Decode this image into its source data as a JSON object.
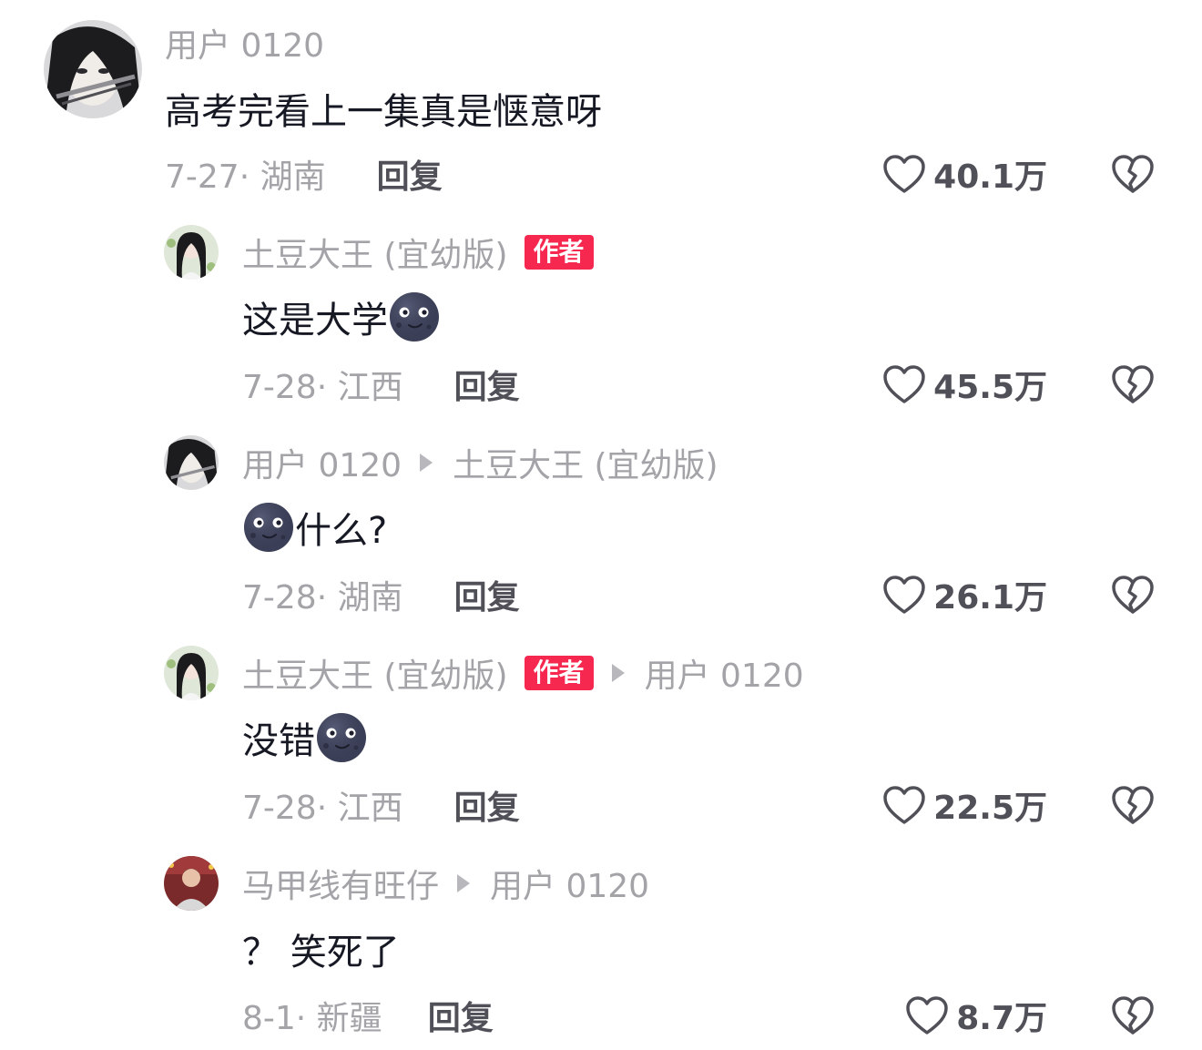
{
  "comments": [
    {
      "username": "用户 0120",
      "text": "高考完看上一集真是惬意呀",
      "date": "7-27· 湖南",
      "reply_label": "回复",
      "likes": "40.1万"
    },
    {
      "username": "土豆大王 (宜幼版)",
      "badge": "作者",
      "text": "这是大学",
      "emoji": "moon-face-emoji",
      "date": "7-28· 江西",
      "reply_label": "回复",
      "likes": "45.5万"
    },
    {
      "username": "用户 0120",
      "reply_to": "土豆大王 (宜幼版)",
      "text": "什么?",
      "emoji": "moon-face-emoji",
      "date": "7-28· 湖南",
      "reply_label": "回复",
      "likes": "26.1万"
    },
    {
      "username": "土豆大王 (宜幼版)",
      "badge": "作者",
      "reply_to": "用户 0120",
      "text": "没错",
      "emoji": "moon-face-emoji",
      "date": "7-28· 江西",
      "reply_label": "回复",
      "likes": "22.5万"
    },
    {
      "username": "马甲线有旺仔",
      "reply_to": "用户 0120",
      "text": "？ 笑死了",
      "date": "8-1· 新疆",
      "reply_label": "回复",
      "likes": "8.7万"
    }
  ],
  "icons": {
    "like": "heart-outline-icon",
    "dislike": "broken-heart-icon"
  },
  "colors": {
    "author_badge": "#f62850",
    "secondary_text": "#a3a3a8",
    "primary_text": "#161823"
  }
}
